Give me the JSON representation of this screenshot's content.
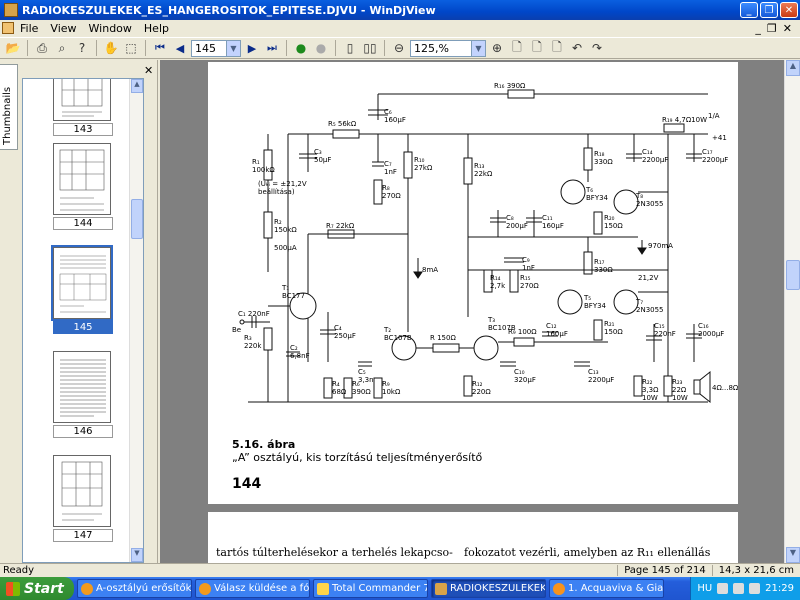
{
  "window": {
    "title": "RADIOKESZULEKEK_ES_HANGEROSITOK_EPITESE.DJVU - WinDjView"
  },
  "menu": {
    "items": [
      "File",
      "View",
      "Window",
      "Help"
    ]
  },
  "toolbar": {
    "page_value": "145",
    "zoom_value": "125,%"
  },
  "sidebar": {
    "tab_label": "Thumbnails",
    "thumbnails": [
      {
        "label": "143"
      },
      {
        "label": "144"
      },
      {
        "label": "145",
        "selected": true
      },
      {
        "label": "146"
      },
      {
        "label": "147"
      }
    ]
  },
  "document": {
    "figure_number": "5.16. ábra",
    "figure_caption": "„A” osztályú, kis torzítású teljesítményerősítő",
    "page_number": "144",
    "next_text_left": "tartós túlterhelésekor a terhelés lekapcso-",
    "next_text_right": "fokozatot vezérli, amelyben az R₁₁ ellenállás",
    "schematic_labels": [
      "R₁₆ 390Ω",
      "C₆\n160µF",
      "R₅ 56kΩ",
      "C₃\n50µF",
      "R₁\n100kΩ",
      "(Uₖᵢ = ±21,2V\nbeállítása)",
      "C₇\n1nF",
      "R₈\n270Ω",
      "R₁₀\n27kΩ",
      "R₁₃\n22kΩ",
      "R₁₈\n330Ω",
      "T₆\nBFY34",
      "T₈\n2N3055",
      "R₁₉ 4,7Ω10W",
      "1/A",
      "+41",
      "C₁₄\n2200µF",
      "C₁₇\n2200µF",
      "R₂\n150kΩ",
      "R₇ 22kΩ",
      "500µA",
      "8mA",
      "C₈\n200µF",
      "C₁₁\n160µF",
      "R₂₀\n150Ω",
      "970mA",
      "C₉\n1nF",
      "R₁₄\n2,7k",
      "R₁₅\n270Ω",
      "R₁₇\n330Ω",
      "T₅\nBFY34",
      "T₇\n2N3055",
      "21,2V",
      "T₁\nBC177",
      "C₁ 220nF",
      "Be",
      "R₃\n220k",
      "C₂\n6,8nF",
      "C₄\n250µF",
      "T₂\nBC107B",
      "T₃\nBC107B",
      "R 150Ω",
      "R₉ 100Ω",
      "C₁₂\n160µF",
      "R₂₁\n150Ω",
      "C₁₅\n220nF",
      "C₁₆\n2000µF",
      "C₅\n3,3n",
      "R₄\n68Ω",
      "R₆\n390Ω",
      "R₉\n10kΩ",
      "R₁₂\n220Ω",
      "C₁₀\n320µF",
      "C₁₃\n2200µF",
      "R₂₂\n3,3Ω\n10W",
      "R₂₃\n22Ω\n10W",
      "4Ω...8Ω"
    ]
  },
  "status": {
    "left": "Ready",
    "page_of": "Page 145 of 214",
    "size": "14,3 x 21,6 cm"
  },
  "taskbar": {
    "start_label": "Start",
    "tasks": [
      "A-osztályú erősítők -...",
      "Válasz küldése a fór...",
      "Total Commander 7....",
      "RADIOKESZULEKEK_...",
      "1. Acquaviva & Giac..."
    ],
    "lang": "HU",
    "clock": "21:29"
  }
}
